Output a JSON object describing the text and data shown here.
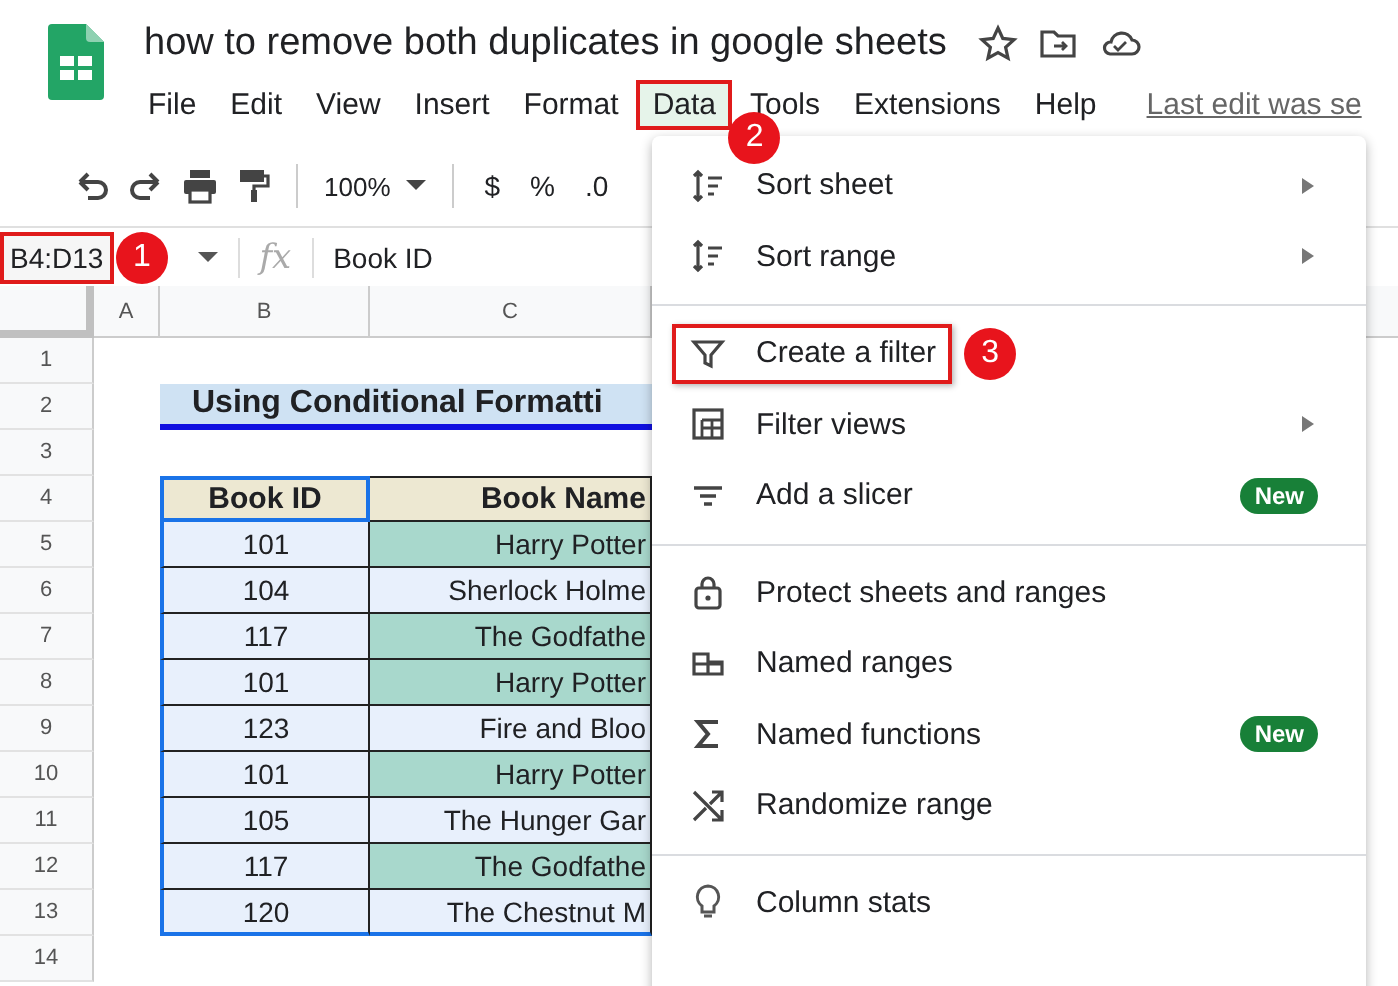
{
  "title": "how to remove both duplicates in google sheets",
  "menubar": [
    {
      "label": "File",
      "selected": false
    },
    {
      "label": "Edit",
      "selected": false
    },
    {
      "label": "View",
      "selected": false
    },
    {
      "label": "Insert",
      "selected": false
    },
    {
      "label": "Format",
      "selected": false
    },
    {
      "label": "Data",
      "selected": true,
      "callout": "2"
    },
    {
      "label": "Tools",
      "selected": false
    },
    {
      "label": "Extensions",
      "selected": false
    },
    {
      "label": "Help",
      "selected": false
    }
  ],
  "last_edit": "Last edit was se",
  "toolbar": {
    "zoom": "100%",
    "currency": "$",
    "percent": "%",
    "decimal": ".0"
  },
  "name_box": {
    "value": "B4:D13",
    "callout": "1"
  },
  "function_label": "fx",
  "formula": "Book ID",
  "columns": [
    "A",
    "B",
    "C"
  ],
  "row_numbers": [
    "1",
    "2",
    "3",
    "4",
    "5",
    "6",
    "7",
    "8",
    "9",
    "10",
    "11",
    "12",
    "13",
    "14"
  ],
  "sheet_title": "Using Conditional Formatti",
  "table": {
    "columns": [
      "Book ID",
      "Book Name"
    ],
    "rows": [
      {
        "id": "101",
        "name": "Harry Potter",
        "highlighted": true
      },
      {
        "id": "104",
        "name": "Sherlock Holme",
        "highlighted": false
      },
      {
        "id": "117",
        "name": "The Godfathe",
        "highlighted": true
      },
      {
        "id": "101",
        "name": "Harry Potter",
        "highlighted": true
      },
      {
        "id": "123",
        "name": "Fire and Bloo",
        "highlighted": false
      },
      {
        "id": "101",
        "name": "Harry Potter",
        "highlighted": true
      },
      {
        "id": "105",
        "name": "The Hunger Gar",
        "highlighted": false
      },
      {
        "id": "117",
        "name": "The Godfathe",
        "highlighted": true
      },
      {
        "id": "120",
        "name": "The Chestnut M",
        "highlighted": false
      }
    ]
  },
  "data_menu": {
    "sections": [
      [
        {
          "label": "Sort sheet",
          "submenu": true
        },
        {
          "label": "Sort range",
          "submenu": true
        }
      ],
      [
        {
          "label": "Create a filter",
          "submenu": false,
          "callout": "3"
        },
        {
          "label": "Filter views",
          "submenu": true
        },
        {
          "label": "Add a slicer",
          "submenu": false,
          "badge": "New"
        }
      ],
      [
        {
          "label": "Protect sheets and ranges",
          "submenu": false
        },
        {
          "label": "Named ranges",
          "submenu": false
        },
        {
          "label": "Named functions",
          "submenu": false,
          "badge": "New"
        },
        {
          "label": "Randomize range",
          "submenu": false
        }
      ],
      [
        {
          "label": "Column stats",
          "submenu": false
        }
      ]
    ]
  }
}
